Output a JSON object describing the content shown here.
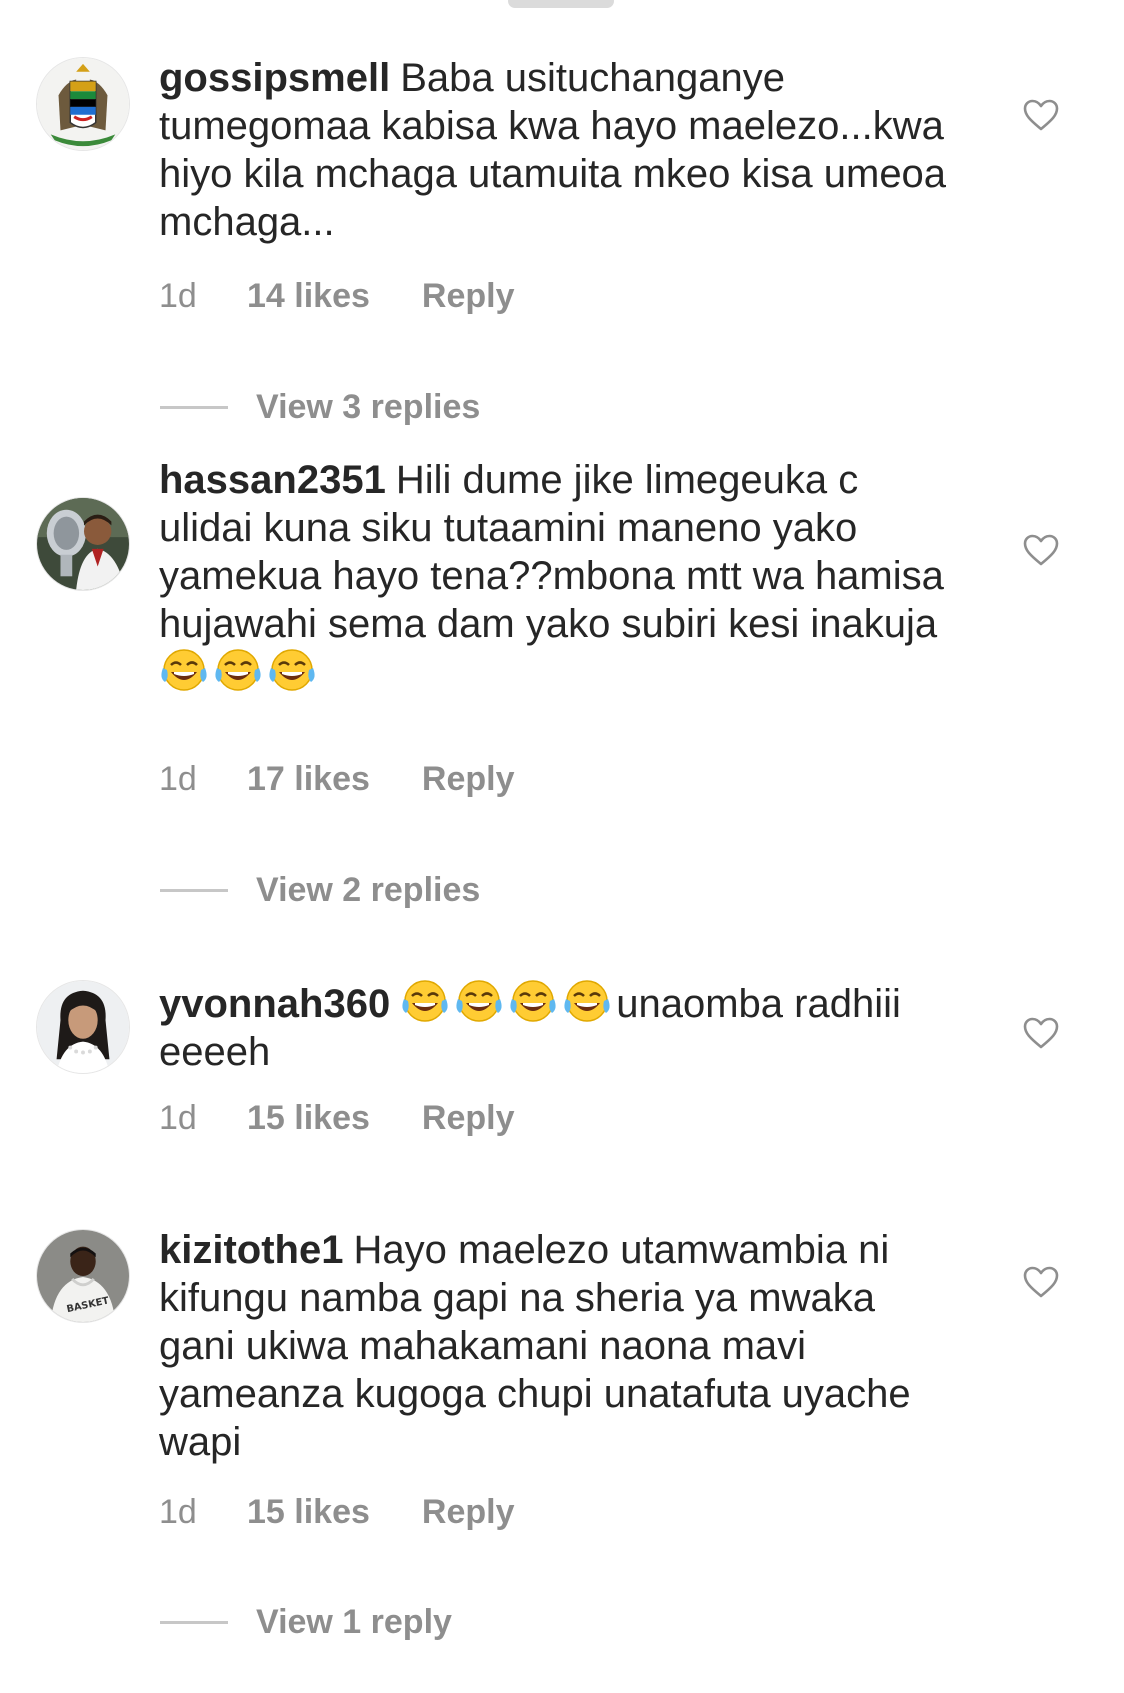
{
  "comments": [
    {
      "username": "gossipsmell",
      "text": "Baba usituchanganye tumegomaa kabisa kwa hayo maelezo...kwa hiyo kila mchaga utamuita mkeo kisa umeoa mchaga...",
      "time": "1d",
      "likes": "14 likes",
      "reply": "Reply",
      "view_replies": "View 3 replies",
      "avatar_icon": "coat-of-arms-avatar"
    },
    {
      "username": "hassan2351",
      "text": "Hili dume jike limegeuka c ulidai kuna siku tutaamini maneno yako yamekua hayo tena??mbona mtt wa hamisa hujawahi sema dam yako subiri kesi inakuja",
      "emoji_suffix": "😂😂😂",
      "time": "1d",
      "likes": "17 likes",
      "reply": "Reply",
      "view_replies": "View 2 replies",
      "avatar_icon": "man-with-trophy-avatar"
    },
    {
      "username": "yvonnah360",
      "emoji_prefix": "😂😂😂😂",
      "text": "unaomba radhiii eeeeh",
      "time": "1d",
      "likes": "15 likes",
      "reply": "Reply",
      "avatar_icon": "woman-avatar"
    },
    {
      "username": "kizitothe1",
      "text": "Hayo maelezo utamwambia ni kifungu namba gapi na sheria ya mwaka gani ukiwa mahakamani naona mavi yameanza kugoga chupi unatafuta uyache wapi",
      "time": "1d",
      "likes": "15 likes",
      "reply": "Reply",
      "view_replies": "View 1 reply",
      "avatar_icon": "man-white-hoodie-avatar"
    }
  ],
  "colors": {
    "text": "#262626",
    "secondary": "#8e8e8e",
    "divider": "#c7c7c7"
  },
  "icons": {
    "like": "heart-icon",
    "emoji": "face-with-tears-of-joy"
  }
}
